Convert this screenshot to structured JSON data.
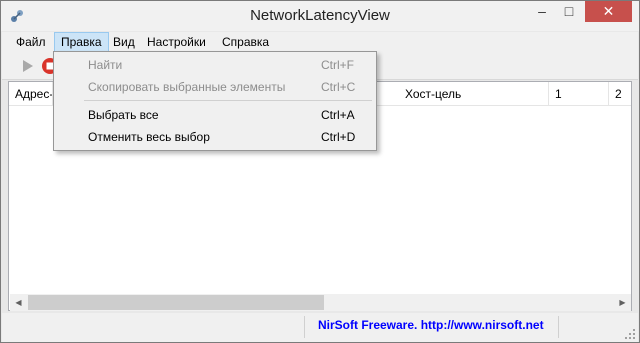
{
  "window": {
    "title": "NetworkLatencyView",
    "controls": {
      "minimize": "–",
      "maximize": "□",
      "close": "✕"
    }
  },
  "menubar": {
    "items": [
      {
        "label": "Файл"
      },
      {
        "label": "Правка",
        "active": true
      },
      {
        "label": "Вид"
      },
      {
        "label": "Настройки"
      },
      {
        "label": "Справка"
      }
    ]
  },
  "toolbar": {
    "buttons": [
      {
        "icon": "play-icon"
      },
      {
        "icon": "stop-icon"
      }
    ]
  },
  "listview": {
    "columns": [
      "Адрес-",
      "Хост-цель",
      "1",
      "2"
    ]
  },
  "dropdown": {
    "items": [
      {
        "label": "Найти",
        "shortcut": "Ctrl+F",
        "enabled": false
      },
      {
        "label": "Скопировать выбранные элементы",
        "shortcut": "Ctrl+C",
        "enabled": false
      },
      {
        "label": "Выбрать все",
        "shortcut": "Ctrl+A",
        "enabled": true
      },
      {
        "label": "Отменить весь выбор",
        "shortcut": "Ctrl+D",
        "enabled": true
      }
    ]
  },
  "statusbar": {
    "link": "NirSoft Freeware.  http://www.nirsoft.net"
  },
  "colors": {
    "close_button": "#c7504c",
    "menu_highlight": "#cce4f7",
    "status_link": "#0000ff"
  }
}
